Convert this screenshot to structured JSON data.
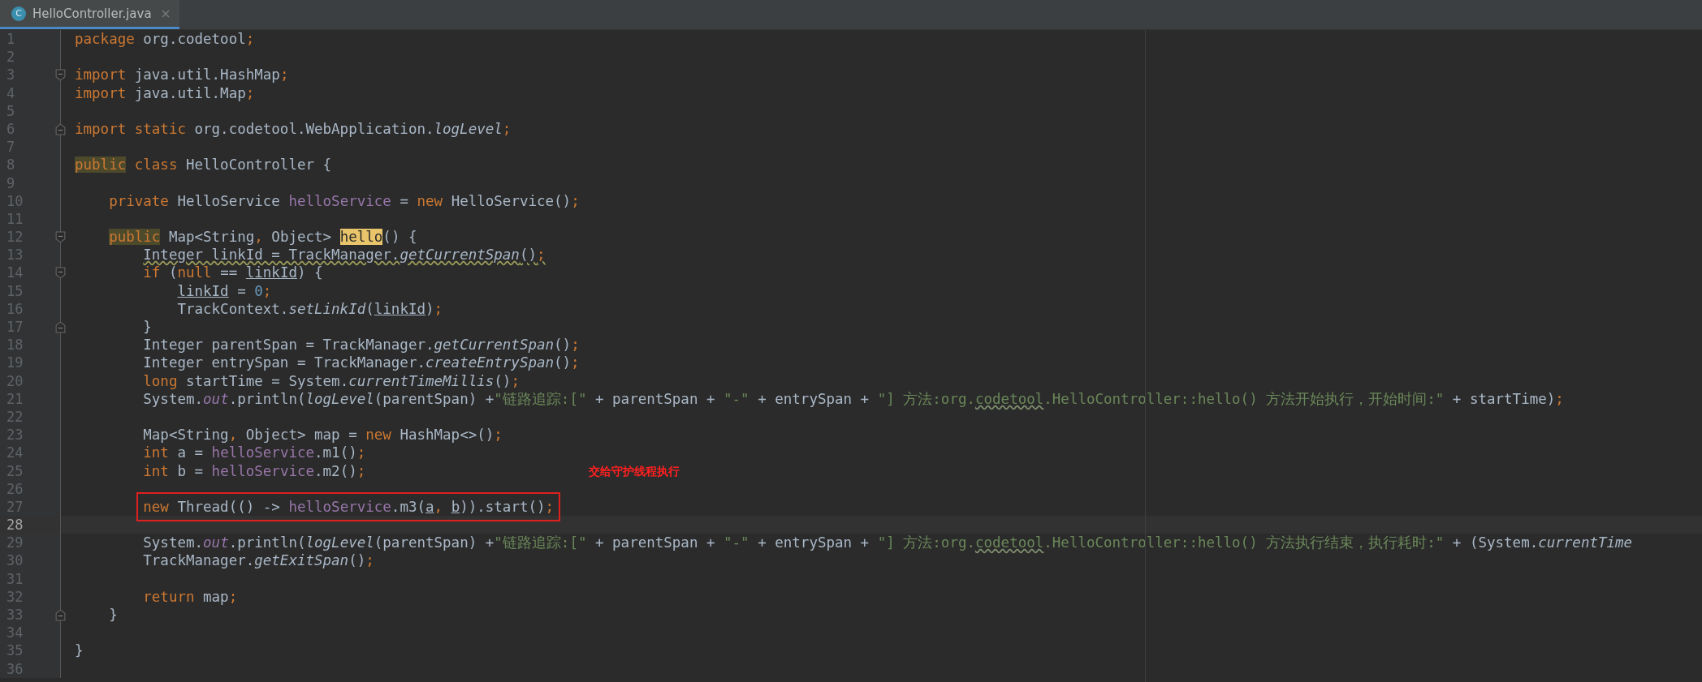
{
  "tabs": [
    {
      "title": "HelloController.java",
      "icon_letter": "C",
      "selected": true
    }
  ],
  "lines": [
    {
      "number": "1",
      "current": false,
      "boxed": false,
      "tokens": [
        {
          "kind": "keyword",
          "text": "package"
        },
        {
          "kind": "plain",
          "text": " org.codetool"
        },
        {
          "kind": "keyword",
          "text": ";"
        }
      ]
    },
    {
      "number": "2",
      "current": false,
      "boxed": false
    },
    {
      "number": "3",
      "current": false,
      "boxed": false,
      "fold": {
        "kind": "start"
      },
      "tokens": [
        {
          "kind": "keyword",
          "text": "import"
        },
        {
          "kind": "plain",
          "text": " java.util.HashMap"
        },
        {
          "kind": "keyword",
          "text": ";"
        }
      ]
    },
    {
      "number": "4",
      "current": false,
      "boxed": false,
      "tokens": [
        {
          "kind": "keyword",
          "text": "import"
        },
        {
          "kind": "plain",
          "text": " java.util.Map"
        },
        {
          "kind": "keyword",
          "text": ";"
        }
      ]
    },
    {
      "number": "5",
      "current": false,
      "boxed": false
    },
    {
      "number": "6",
      "current": false,
      "boxed": false,
      "fold": {
        "kind": "end"
      },
      "tokens": [
        {
          "kind": "keyword",
          "text": "import static"
        },
        {
          "kind": "plain",
          "text": " org.codetool.WebApplication."
        },
        {
          "kind": "italic",
          "text": "logLevel"
        },
        {
          "kind": "keyword",
          "text": ";"
        }
      ]
    },
    {
      "number": "7",
      "current": false,
      "boxed": false
    },
    {
      "number": "8",
      "current": false,
      "boxed": false,
      "tokens": [
        {
          "kind": "keyword-match",
          "text": "public"
        },
        {
          "kind": "keyword",
          "text": " class"
        },
        {
          "kind": "plain",
          "text": " HelloController {"
        }
      ]
    },
    {
      "number": "9",
      "current": false,
      "boxed": false
    },
    {
      "number": "10",
      "current": false,
      "boxed": false,
      "tokens": [
        {
          "kind": "keyword",
          "text": "    private"
        },
        {
          "kind": "plain",
          "text": " HelloService "
        },
        {
          "kind": "field",
          "text": "helloService"
        },
        {
          "kind": "plain",
          "text": " = "
        },
        {
          "kind": "keyword",
          "text": "new"
        },
        {
          "kind": "plain",
          "text": " HelloService()"
        },
        {
          "kind": "keyword",
          "text": ";"
        }
      ]
    },
    {
      "number": "11",
      "current": false,
      "boxed": false
    },
    {
      "number": "12",
      "current": false,
      "boxed": false,
      "fold": {
        "kind": "start"
      },
      "tokens": [
        {
          "kind": "keyword-match",
          "text": "    public"
        },
        {
          "kind": "plain",
          "text": " Map<String"
        },
        {
          "kind": "keyword",
          "text": ","
        },
        {
          "kind": "plain",
          "text": " Object> "
        },
        {
          "kind": "method-match",
          "text": "hello"
        },
        {
          "kind": "plain",
          "text": "() {"
        }
      ]
    },
    {
      "number": "13",
      "current": false,
      "boxed": false,
      "tokens": [
        {
          "kind": "wavy",
          "text": "        Integer linkId = TrackManager."
        },
        {
          "kind": "wavy-italic",
          "text": "getCurrentSpan"
        },
        {
          "kind": "wavy",
          "text": "()"
        },
        {
          "kind": "wavy-keyword",
          "text": ";"
        }
      ]
    },
    {
      "number": "14",
      "current": false,
      "boxed": false,
      "fold": {
        "kind": "start"
      },
      "tokens": [
        {
          "kind": "keyword",
          "text": "        if"
        },
        {
          "kind": "plain",
          "text": " ("
        },
        {
          "kind": "keyword",
          "text": "null"
        },
        {
          "kind": "plain",
          "text": " == "
        },
        {
          "kind": "underlined",
          "text": "linkId"
        },
        {
          "kind": "plain",
          "text": ") {"
        }
      ]
    },
    {
      "number": "15",
      "current": false,
      "boxed": false,
      "tokens": [
        {
          "kind": "underlined",
          "text": "            linkId"
        },
        {
          "kind": "plain",
          "text": " = "
        },
        {
          "kind": "number",
          "text": "0"
        },
        {
          "kind": "keyword",
          "text": ";"
        }
      ]
    },
    {
      "number": "16",
      "current": false,
      "boxed": false,
      "tokens": [
        {
          "kind": "plain",
          "text": "            TrackContext."
        },
        {
          "kind": "italic",
          "text": "setLinkId"
        },
        {
          "kind": "plain",
          "text": "("
        },
        {
          "kind": "underlined",
          "text": "linkId"
        },
        {
          "kind": "plain",
          "text": ")"
        },
        {
          "kind": "keyword",
          "text": ";"
        }
      ]
    },
    {
      "number": "17",
      "current": false,
      "boxed": false,
      "fold": {
        "kind": "end"
      },
      "tokens": [
        {
          "kind": "plain",
          "text": "        }"
        }
      ]
    },
    {
      "number": "18",
      "current": false,
      "boxed": false,
      "tokens": [
        {
          "kind": "plain",
          "text": "        Integer parentSpan = TrackManager."
        },
        {
          "kind": "italic",
          "text": "getCurrentSpan"
        },
        {
          "kind": "plain",
          "text": "()"
        },
        {
          "kind": "keyword",
          "text": ";"
        }
      ]
    },
    {
      "number": "19",
      "current": false,
      "boxed": false,
      "tokens": [
        {
          "kind": "plain",
          "text": "        Integer entrySpan = TrackManager."
        },
        {
          "kind": "italic",
          "text": "createEntrySpan"
        },
        {
          "kind": "plain",
          "text": "()"
        },
        {
          "kind": "keyword",
          "text": ";"
        }
      ]
    },
    {
      "number": "20",
      "current": false,
      "boxed": false,
      "tokens": [
        {
          "kind": "keyword",
          "text": "        long"
        },
        {
          "kind": "plain",
          "text": " startTime = System."
        },
        {
          "kind": "italic",
          "text": "currentTimeMillis"
        },
        {
          "kind": "plain",
          "text": "()"
        },
        {
          "kind": "keyword",
          "text": ";"
        }
      ]
    },
    {
      "number": "21",
      "current": false,
      "boxed": false,
      "tokens": [
        {
          "kind": "plain",
          "text": "        System."
        },
        {
          "kind": "static-field",
          "text": "out"
        },
        {
          "kind": "plain",
          "text": ".println("
        },
        {
          "kind": "italic",
          "text": "logLevel"
        },
        {
          "kind": "plain",
          "text": "(parentSpan) +"
        },
        {
          "kind": "string",
          "text": "\"链路追踪:[\""
        },
        {
          "kind": "plain",
          "text": " + parentSpan + "
        },
        {
          "kind": "string",
          "text": "\"-\""
        },
        {
          "kind": "plain",
          "text": " + entrySpan + "
        },
        {
          "kind": "string",
          "text": "\"] 方法:org."
        },
        {
          "kind": "string-wavy",
          "text": "codetool"
        },
        {
          "kind": "string",
          "text": ".HelloController::hello() 方法开始执行，开始时间:\""
        },
        {
          "kind": "plain",
          "text": " + startTime)"
        },
        {
          "kind": "keyword",
          "text": ";"
        }
      ]
    },
    {
      "number": "22",
      "current": false,
      "boxed": false
    },
    {
      "number": "23",
      "current": false,
      "boxed": false,
      "tokens": [
        {
          "kind": "plain",
          "text": "        Map<String"
        },
        {
          "kind": "keyword",
          "text": ","
        },
        {
          "kind": "plain",
          "text": " Object> map = "
        },
        {
          "kind": "keyword",
          "text": "new"
        },
        {
          "kind": "plain",
          "text": " HashMap<>()"
        },
        {
          "kind": "keyword",
          "text": ";"
        }
      ]
    },
    {
      "number": "24",
      "current": false,
      "boxed": false,
      "tokens": [
        {
          "kind": "keyword",
          "text": "        int"
        },
        {
          "kind": "plain",
          "text": " a = "
        },
        {
          "kind": "field",
          "text": "helloService"
        },
        {
          "kind": "plain",
          "text": ".m1()"
        },
        {
          "kind": "keyword",
          "text": ";"
        }
      ]
    },
    {
      "number": "25",
      "current": false,
      "boxed": false,
      "note": "交给守护线程执行",
      "tokens": [
        {
          "kind": "keyword",
          "text": "        int"
        },
        {
          "kind": "plain",
          "text": " b = "
        },
        {
          "kind": "field",
          "text": "helloService"
        },
        {
          "kind": "plain",
          "text": ".m2()"
        },
        {
          "kind": "keyword",
          "text": ";"
        }
      ]
    },
    {
      "number": "26",
      "current": false,
      "boxed": false
    },
    {
      "number": "27",
      "current": false,
      "boxed": true,
      "tokens": [
        {
          "kind": "keyword",
          "text": "        new"
        },
        {
          "kind": "plain",
          "text": " Thread(() -> "
        },
        {
          "kind": "field",
          "text": "helloService"
        },
        {
          "kind": "plain",
          "text": ".m3("
        },
        {
          "kind": "underlined",
          "text": "a"
        },
        {
          "kind": "keyword",
          "text": ", "
        },
        {
          "kind": "underlined",
          "text": "b"
        },
        {
          "kind": "plain",
          "text": ")).start()"
        },
        {
          "kind": "keyword",
          "text": ";"
        }
      ]
    },
    {
      "number": "28",
      "current": true,
      "boxed": false
    },
    {
      "number": "29",
      "current": false,
      "boxed": false,
      "tokens": [
        {
          "kind": "plain",
          "text": "        System."
        },
        {
          "kind": "static-field",
          "text": "out"
        },
        {
          "kind": "plain",
          "text": ".println("
        },
        {
          "kind": "italic",
          "text": "logLevel"
        },
        {
          "kind": "plain",
          "text": "(parentSpan) +"
        },
        {
          "kind": "string",
          "text": "\"链路追踪:[\""
        },
        {
          "kind": "plain",
          "text": " + parentSpan + "
        },
        {
          "kind": "string",
          "text": "\"-\""
        },
        {
          "kind": "plain",
          "text": " + entrySpan + "
        },
        {
          "kind": "string",
          "text": "\"] 方法:org."
        },
        {
          "kind": "string-wavy",
          "text": "codetool"
        },
        {
          "kind": "string",
          "text": ".HelloController::hello() 方法执行结束，执行耗时:\""
        },
        {
          "kind": "plain",
          "text": " + (System."
        },
        {
          "kind": "italic",
          "text": "currentTime"
        }
      ]
    },
    {
      "number": "30",
      "current": false,
      "boxed": false,
      "tokens": [
        {
          "kind": "plain",
          "text": "        TrackManager."
        },
        {
          "kind": "italic",
          "text": "getExitSpan"
        },
        {
          "kind": "plain",
          "text": "()"
        },
        {
          "kind": "keyword",
          "text": ";"
        }
      ]
    },
    {
      "number": "31",
      "current": false,
      "boxed": false
    },
    {
      "number": "32",
      "current": false,
      "boxed": false,
      "tokens": [
        {
          "kind": "keyword",
          "text": "        return"
        },
        {
          "kind": "plain",
          "text": " map"
        },
        {
          "kind": "keyword",
          "text": ";"
        }
      ]
    },
    {
      "number": "33",
      "current": false,
      "boxed": false,
      "fold": {
        "kind": "end"
      },
      "tokens": [
        {
          "kind": "plain",
          "text": "    }"
        }
      ]
    },
    {
      "number": "34",
      "current": false,
      "boxed": false
    },
    {
      "number": "35",
      "current": false,
      "boxed": false,
      "tokens": [
        {
          "kind": "plain",
          "text": "}"
        }
      ]
    },
    {
      "number": "36",
      "current": false,
      "boxed": false
    }
  ]
}
